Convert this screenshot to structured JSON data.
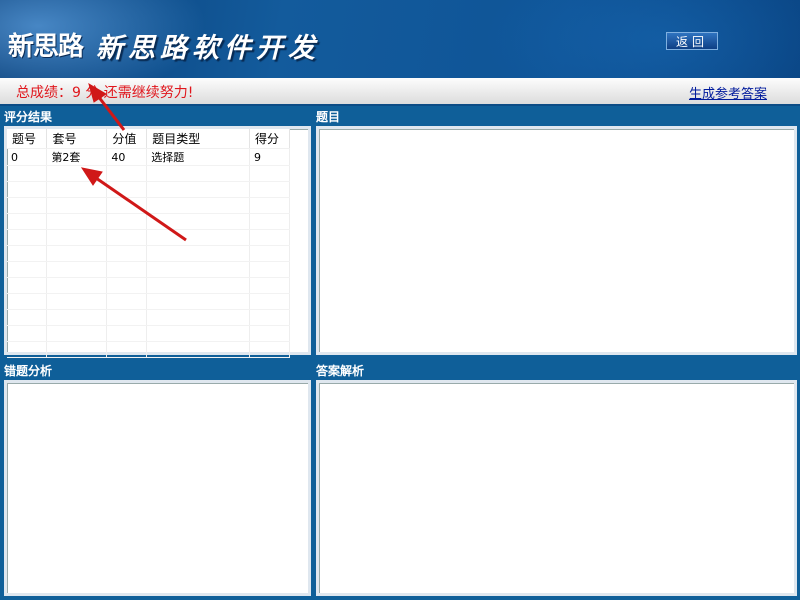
{
  "header": {
    "logo_text": "新思路",
    "title": "新思路软件开发",
    "back_button": "返回"
  },
  "scorebar": {
    "score_message": "总成绩：9 分,还需继续努力!",
    "generate_answers_link": "生成参考答案"
  },
  "panels": {
    "results_label": "评分结果",
    "question_label": "题目",
    "wrong_analysis_label": "错题分析",
    "answer_analysis_label": "答案解析"
  },
  "results_table": {
    "columns": [
      "题号",
      "套号",
      "分值",
      "题目类型",
      "得分"
    ],
    "rows": [
      [
        "0",
        "第2套",
        "40",
        "选择题",
        "9"
      ]
    ]
  },
  "colors": {
    "background": "#0f5f99",
    "score_text": "#e0161c",
    "link": "#001a9c",
    "annotation_arrow": "#d01818"
  }
}
